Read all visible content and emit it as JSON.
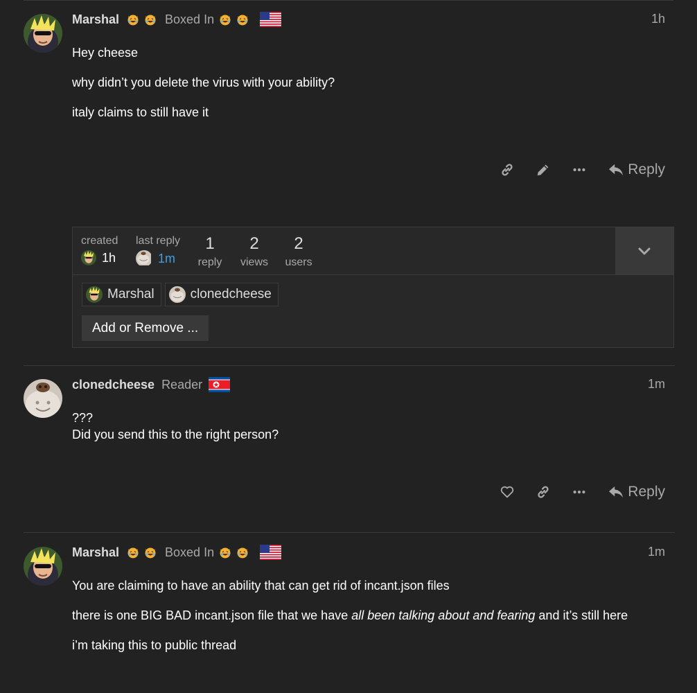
{
  "posts": [
    {
      "username": "Marshal",
      "user_title": "Boxed In",
      "date": "1h",
      "flag": "us-flag",
      "body": [
        "Hey cheese",
        "why didn’t you delete the virus with your ability?",
        "italy claims to still have it"
      ]
    },
    {
      "username": "clonedcheese",
      "user_title": "Reader",
      "date": "1m",
      "flag": "north-korea-flag",
      "body": [
        "???",
        "Did you send this to the right person?"
      ]
    },
    {
      "username": "Marshal",
      "user_title": "Boxed In",
      "date": "1m",
      "flag": "us-flag",
      "body_1": "You are claiming to have an ability that can get rid of incant.json files",
      "body_2a": "there is one BIG BAD incant.json file that we have ",
      "body_2b": "all been talking about and fearing",
      "body_2c": " and it’s still here",
      "body_3": "i’m taking this to public thread"
    }
  ],
  "actions": {
    "reply_label": "Reply",
    "icons": [
      "link-icon",
      "pencil-icon",
      "more-icon",
      "heart-icon",
      "reply-icon"
    ]
  },
  "topic_map": {
    "created_label": "created",
    "created_value": "1h",
    "last_reply_label": "last reply",
    "last_reply_value": "1m",
    "replies_num": "1",
    "replies_label": "reply",
    "views_num": "2",
    "views_label": "views",
    "users_num": "2",
    "users_label": "users",
    "participants": [
      "Marshal",
      "clonedcheese"
    ],
    "add_remove_label": "Add or Remove ..."
  },
  "colors": {
    "background": "#222222",
    "text": "#ffffff",
    "muted": "#a9a9a9",
    "link": "#3fa0e6"
  }
}
